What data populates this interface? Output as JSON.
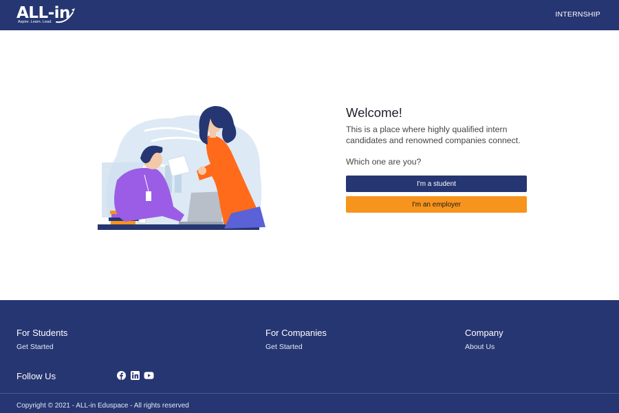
{
  "header": {
    "logo_text": "ALL-in",
    "logo_tagline": "Aspire. Learn. Lead.",
    "nav_link": "INTERNSHIP"
  },
  "main": {
    "title": "Welcome!",
    "description": "This is a place where highly qualified intern candidates and renowned companies connect.",
    "question": "Which one are you?",
    "student_button": "I'm a student",
    "employer_button": "I'm an employer"
  },
  "footer": {
    "students": {
      "heading": "For Students",
      "link": "Get Started"
    },
    "companies": {
      "heading": "For Companies",
      "link": "Get Started"
    },
    "company": {
      "heading": "Company",
      "link": "About Us"
    },
    "follow_heading": "Follow Us",
    "social_icons": [
      "facebook-icon",
      "linkedin-icon",
      "youtube-icon"
    ],
    "copyright": "Copyright © 2021 - ALL-in Eduspace - All rights reserved"
  },
  "colors": {
    "navy": "#263672",
    "orange": "#f7941d",
    "purple": "#9b5de5"
  }
}
